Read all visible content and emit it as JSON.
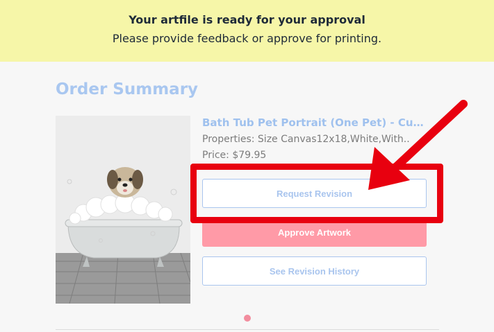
{
  "banner": {
    "title": "Your artfile is ready for your approval",
    "subtitle": "Please provide feedback or approve for printing."
  },
  "order_summary": {
    "heading": "Order Summary",
    "product": {
      "name": "Bath Tub Pet Portrait (One Pet) - Custom Pet Canvas",
      "properties": "Properties: Size Canvas12x18,White,With...",
      "price": "Price: $79.95",
      "image_icon": "pet-in-bathtub-image"
    },
    "buttons": {
      "request_revision": "Request Revision",
      "approve_artwork": "Approve Artwork",
      "see_revision_history": "See Revision History"
    }
  },
  "colors": {
    "banner_bg": "#f6f6a8",
    "accent_blue": "#a9c7f0",
    "approve_pink": "#ff9aa7",
    "annotation_red": "#e8000f"
  },
  "carousel": {
    "active_page": 1,
    "total_pages": 1
  }
}
